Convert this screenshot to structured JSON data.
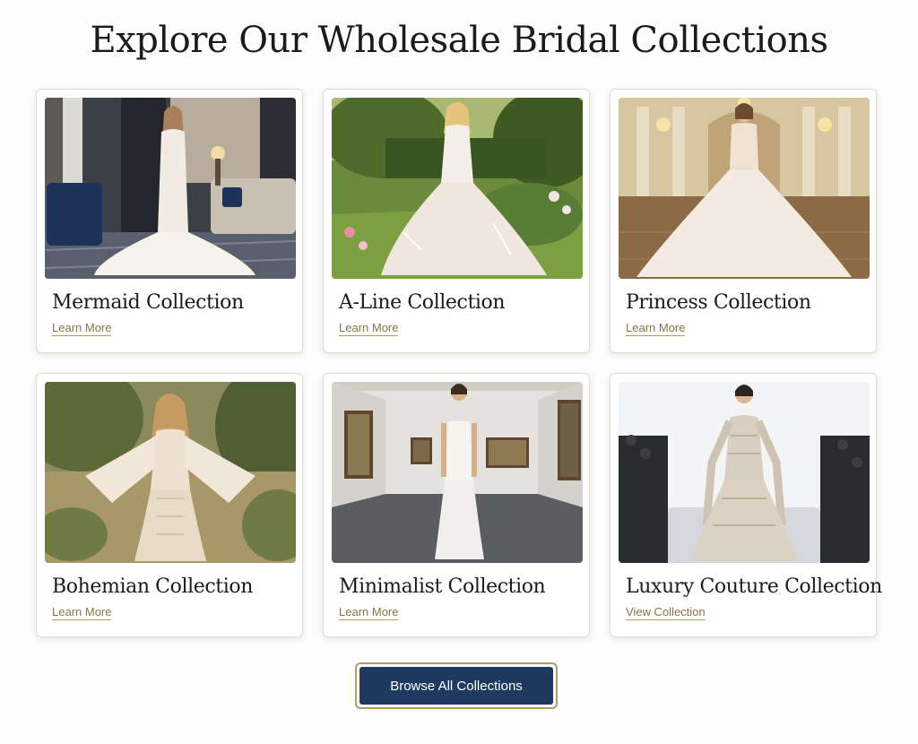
{
  "header": {
    "title": "Explore Our Wholesale Bridal Collections"
  },
  "collections": [
    {
      "title": "Mermaid Collection",
      "link": "Learn More",
      "image": "mermaid-gown-hotel-lounge-photo"
    },
    {
      "title": "A-Line Collection",
      "link": "Learn More",
      "image": "a-line-gown-garden-photo"
    },
    {
      "title": "Princess Collection",
      "link": "Learn More",
      "image": "princess-ballgown-palace-hall-photo"
    },
    {
      "title": "Bohemian Collection",
      "link": "Learn More",
      "image": "bohemian-lace-dress-forest-photo"
    },
    {
      "title": "Minimalist Collection",
      "link": "Learn More",
      "image": "minimalist-gown-art-gallery-photo"
    },
    {
      "title": "Luxury Couture Collection",
      "link": "View Collection",
      "image": "couture-gown-runway-photo"
    }
  ],
  "cta": {
    "label": "Browse All Collections"
  },
  "colors": {
    "accent_gold": "#b49a64",
    "link_gold": "#8a7343",
    "navy": "#1f3a5f",
    "title_text": "#1b1b1b"
  }
}
